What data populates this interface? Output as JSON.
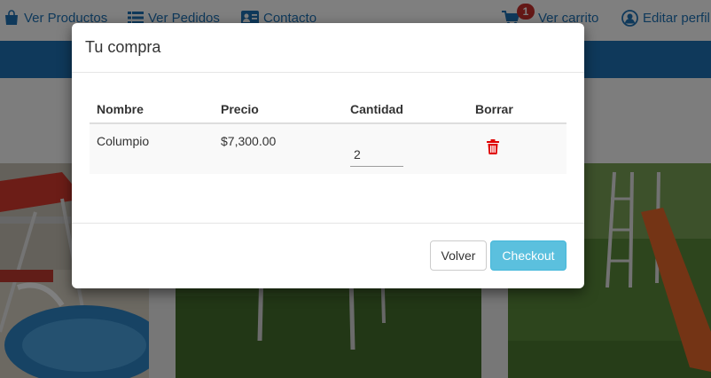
{
  "nav": {
    "products_label": "Ver Productos",
    "orders_label": "Ver Pedidos",
    "contact_label": "Contacto",
    "cart_label": "Ver carrito",
    "cart_count": "1",
    "profile_label": "Editar perfil"
  },
  "modal": {
    "title": "Tu compra",
    "headers": {
      "name": "Nombre",
      "price": "Precio",
      "quantity": "Cantidad",
      "delete": "Borrar"
    },
    "items": [
      {
        "name": "Columpio",
        "price": "$7,300.00",
        "quantity": "2"
      }
    ],
    "back_label": "Volver",
    "checkout_label": "Checkout"
  },
  "colors": {
    "nav_link": "#1f73b7",
    "brand_band": "#1f73b7",
    "badge": "#c9302c",
    "checkout": "#5bc0de",
    "delete_icon": "#e00000"
  },
  "icons": {
    "products": "shopping-bag-icon",
    "orders": "list-icon",
    "contact": "contact-card-icon",
    "cart": "shopping-cart-icon",
    "profile": "user-circle-icon",
    "delete": "trash-icon"
  }
}
